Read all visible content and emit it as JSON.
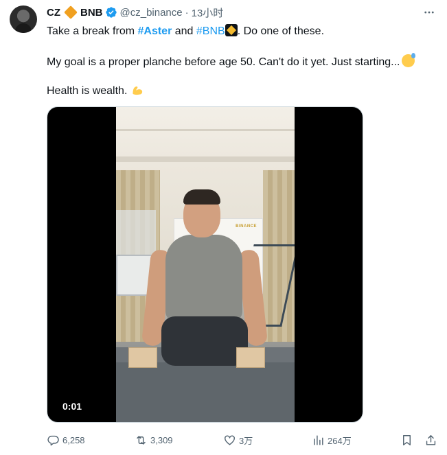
{
  "author": {
    "name": "CZ",
    "badge_label": "BNB",
    "handle": "@cz_binance",
    "separator": "·",
    "time": "13小时"
  },
  "tweet": {
    "line1": {
      "prefix": "Take a break from ",
      "hashtag1": "#Aster",
      "middle": " and ",
      "hashtag2": "#BNB",
      "suffix": ". Do one of these."
    },
    "line2": "My goal is a proper planche before age 50. Can't do it yet. Just starting...",
    "line3": "Health is wealth."
  },
  "media": {
    "timer": "0:01",
    "background_sign": "BINANCE"
  },
  "actions": {
    "replies": "6,258",
    "retweets": "3,309",
    "likes": "3万",
    "views": "264万"
  },
  "icons": {
    "verified": "verified-badge-icon",
    "more": "more-icon",
    "reply": "reply-icon",
    "retweet": "retweet-icon",
    "like": "like-icon",
    "views": "views-icon",
    "bookmark": "bookmark-icon",
    "share": "share-icon"
  },
  "colors": {
    "hashtag": "#1d9bf0",
    "secondary_text": "#536471",
    "verified": "#1d9bf0",
    "badge_diamond": "#f0a020"
  }
}
